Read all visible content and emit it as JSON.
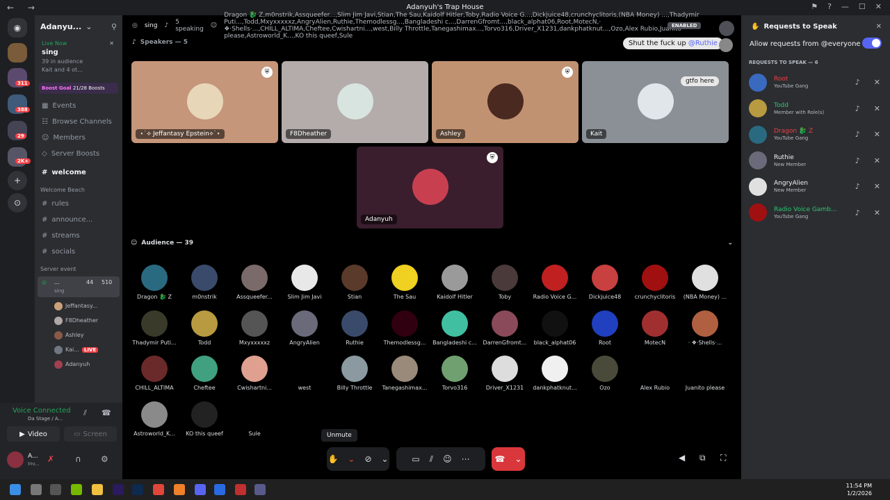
{
  "window": {
    "title": "Adanyuh's Trap House"
  },
  "sidebar": {
    "server_name": "Adanyu...",
    "live": {
      "label": "Live Now",
      "title": "sing",
      "audience": "39 in audience",
      "listeners": "Kait",
      "others": "and 4 ot..."
    },
    "boost": {
      "label": "Boost Goal",
      "progress": "21/28 Boosts"
    },
    "nav": [
      "Events",
      "Browse Channels",
      "Members",
      "Server Boosts"
    ],
    "welcome": "welcome",
    "category_welcome": "Welcome Beach",
    "channels": [
      "rules",
      "announce...",
      "streams",
      "socials"
    ],
    "category_event": "Server event",
    "stage": {
      "name": "...",
      "sub": "sing",
      "count1": "44",
      "count2": "510"
    },
    "voice_users": [
      "Jeffantasy...",
      "F8Dheather",
      "Ashley",
      "Kai...",
      "Adanyuh"
    ],
    "live_badge": "LIVE",
    "voice_connected": "Voice Connected",
    "voice_sub": "Da Stage / A...",
    "video": "Video",
    "screen": "Screen",
    "user": {
      "name": "A...",
      "status": "Inv..."
    }
  },
  "badges": [
    "311",
    "388",
    "29",
    "2K+"
  ],
  "stage": {
    "topic": "sing",
    "speaking": "5 speaking",
    "audience": [
      "Dragon 🐉 Z",
      "m0nstrik",
      "Assqueefer...",
      "Slim Jim Javi",
      "Stian",
      "The Sau",
      "Kaidolf Hitler",
      "Toby",
      "Radio Voice G...",
      "Dickjuice48",
      "crunchyclitoris",
      "(NBA Money) ...",
      "Thadymir Puti...",
      "Todd",
      "Mxyxxxxxz",
      "AngryAlien",
      "Ruthie",
      "Themodlessg...",
      "Bangladeshi c...",
      "DarrenGfromt...",
      "black_alphat06",
      "Root",
      "MotecN",
      "· ❖·Shells·...",
      "CHILL_ALTIMA",
      "Cheftee",
      "Cwishartni...",
      "west",
      "Billy Throttle",
      "Tanegashimax...",
      "Torvo316",
      "Driver_X1231",
      "dankphatknut...",
      "Ozo",
      "Alex Rubio",
      "Juanito please",
      "Astroworld_K...",
      "KO this queef",
      "Sule"
    ],
    "enabled": "ENABLED",
    "speakers_label": "Speakers — 5",
    "chat1": "Shut the fuck up",
    "chat1_mention": "@Ruthie",
    "chat2": "gtfo here",
    "speakers": [
      "⋆˙⟡ Jeffantasy Epstein⟡˙⋆",
      "F8Dheather",
      "Ashley",
      "Kait",
      "Adanyuh"
    ],
    "audience_label": "Audience — 39",
    "tooltip": "Unmute"
  },
  "requests": {
    "title": "Requests to Speak",
    "allow": "Allow requests from @everyone",
    "count_label": "REQUESTS TO SPEAK — 6",
    "items": [
      {
        "name": "Root",
        "role": "YouTube Gang",
        "color": "#f23f43"
      },
      {
        "name": "Todd",
        "role": "Member with Role(s)",
        "color": "#2dc770"
      },
      {
        "name": "Dragon 🐉 Z",
        "role": "YouTube Gang",
        "color": "#f23f43"
      },
      {
        "name": "Ruthie",
        "role": "New Member",
        "color": "#f2f3f5"
      },
      {
        "name": "AngryAlien",
        "role": "New Member",
        "color": "#f2f3f5"
      },
      {
        "name": "Radio Voice Gamb...",
        "role": "YouTube Gang",
        "color": "#2dc770"
      }
    ]
  },
  "clock": {
    "time": "11:54 PM",
    "date": "1/2/2026"
  }
}
